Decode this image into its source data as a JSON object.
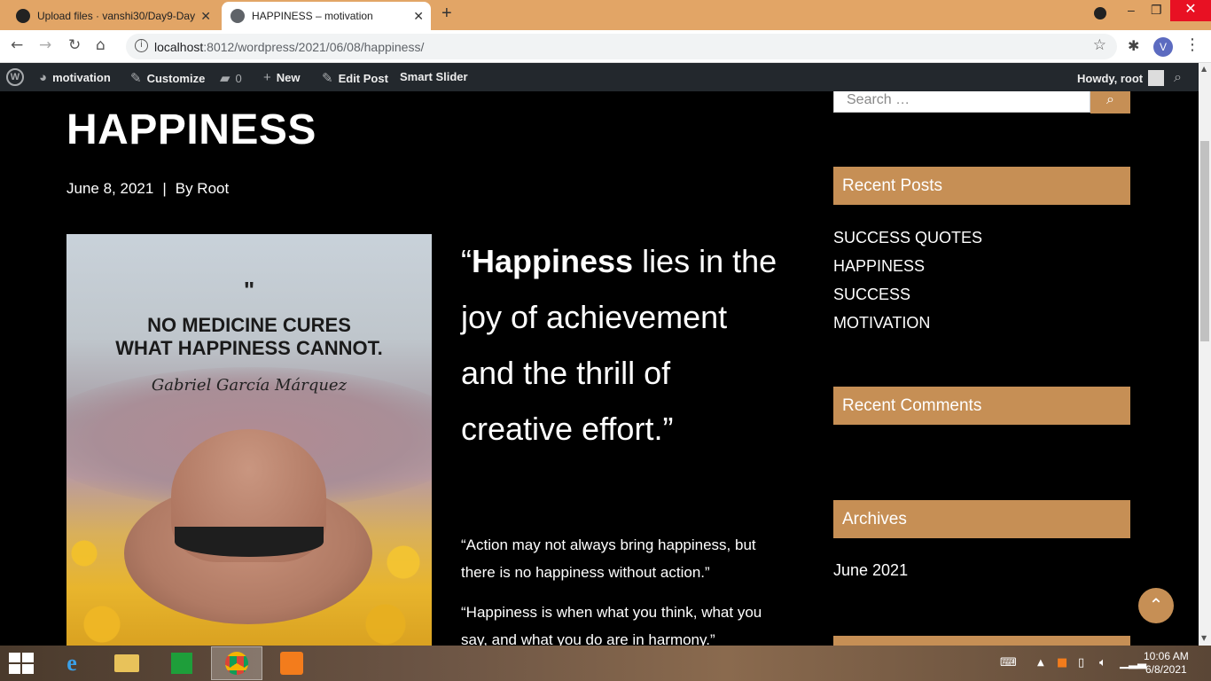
{
  "browser": {
    "tabs": [
      {
        "title": "Upload files · vanshi30/Day9-Day",
        "active": false
      },
      {
        "title": "HAPPINESS – motivation",
        "active": true
      }
    ],
    "new_tab": "+",
    "url_host": "localhost",
    "url_path": ":8012/wordpress/2021/06/08/happiness/",
    "profile_initial": "V"
  },
  "adminbar": {
    "site": "motivation",
    "customize": "Customize",
    "comments_count": "0",
    "new": "New",
    "edit_post": "Edit Post",
    "smart_slider": "Smart Slider",
    "howdy": "Howdy, root"
  },
  "post": {
    "title": "HAPPINESS",
    "date": "June 8, 2021",
    "separator": "|",
    "author": "By Root",
    "featured_image": {
      "quote_mark": "\"",
      "quote_lines": [
        "NO MEDICINE CURES",
        "WHAT HAPPINESS CANNOT."
      ],
      "author": "Gabriel García Márquez"
    },
    "big_quote": {
      "open": "“",
      "bold": "Happiness",
      "rest": " lies in the joy of achievement and the thrill of creative effort.”"
    },
    "small_quotes": [
      "“Action may not always bring happiness, but there is no happiness without action.”",
      "“Happiness is when what you think, what you say, and what you do are in harmony.”"
    ]
  },
  "sidebar": {
    "search_placeholder": "Search …",
    "recent_posts_title": "Recent Posts",
    "recent_posts": [
      "SUCCESS QUOTES",
      "HAPPINESS",
      "SUCCESS",
      "MOTIVATION"
    ],
    "recent_comments_title": "Recent Comments",
    "archives_title": "Archives",
    "archives": [
      "June 2021"
    ]
  },
  "taskbar": {
    "time": "10:06 AM",
    "date": "6/8/2021"
  },
  "colors": {
    "accent": "#c68f55",
    "tabstrip": "#e2a566",
    "adminbar": "#23282d"
  }
}
